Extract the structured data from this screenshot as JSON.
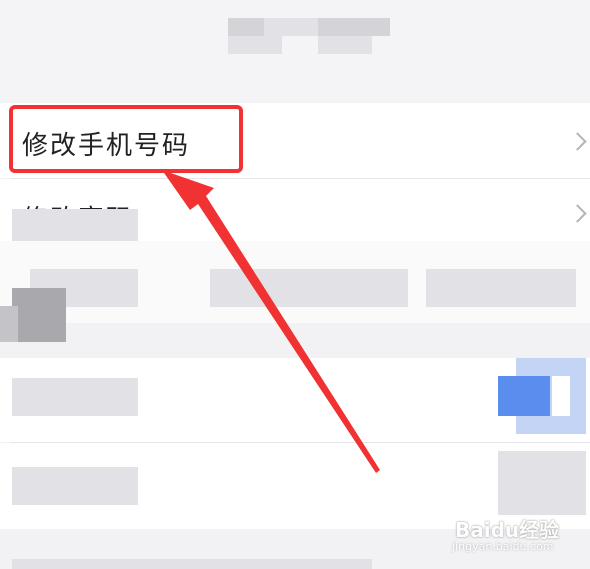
{
  "settings": {
    "change_phone_label": "修改手机号码",
    "change_password_label": "修改密码"
  },
  "watermark": {
    "brand": "Baidu经验",
    "url": "jingyan.baidu.com"
  },
  "colors": {
    "highlight": "#f03232",
    "arrow": "#f03232",
    "background": "#f2f2f5",
    "row": "#ffffff"
  }
}
